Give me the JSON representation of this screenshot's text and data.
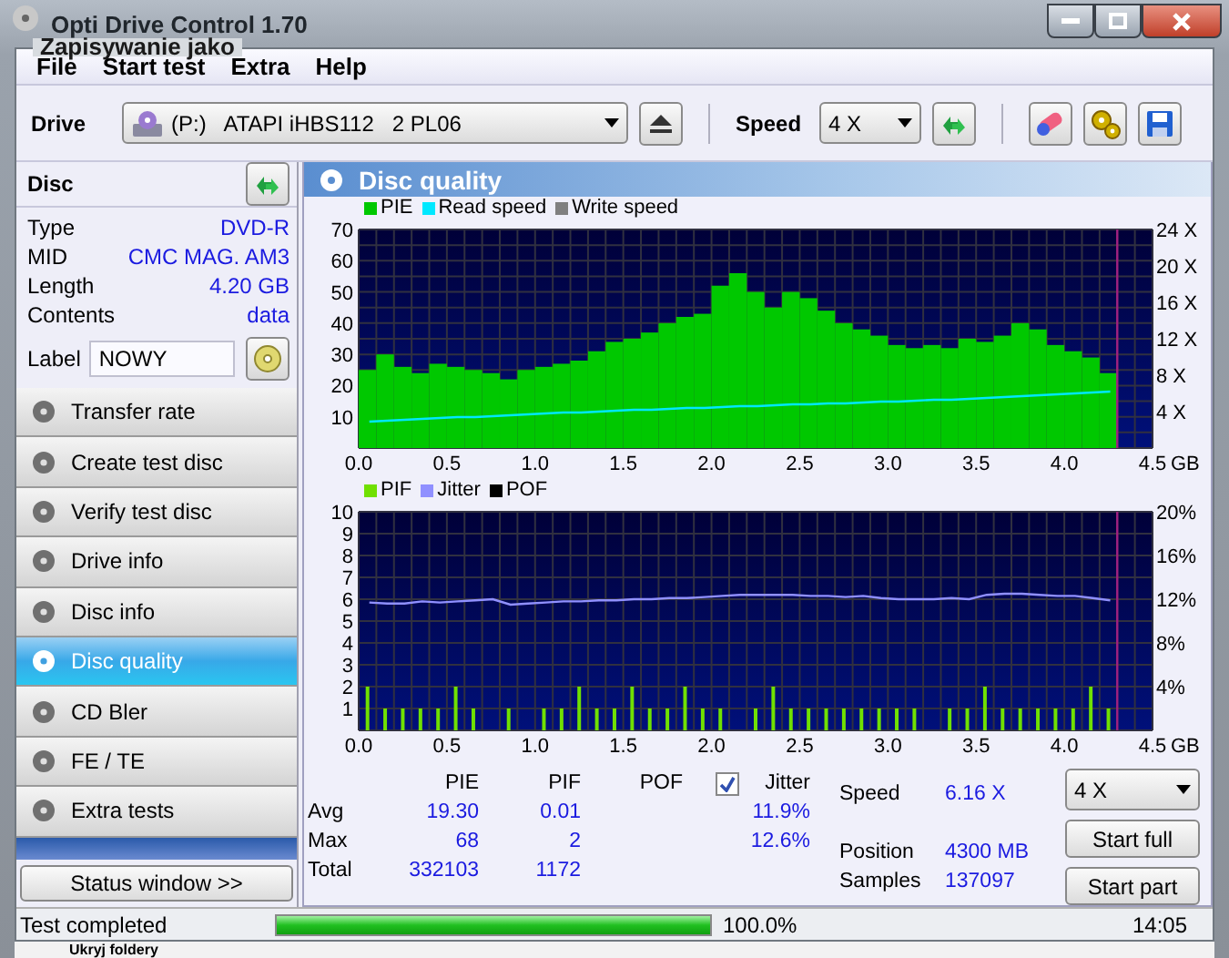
{
  "window": {
    "title": "Opti Drive Control 1.70"
  },
  "background_window": {
    "title": "Zapisywanie jako",
    "footer": "Ukryj foldery"
  },
  "menu": [
    "File",
    "Start test",
    "Extra",
    "Help"
  ],
  "toolbar": {
    "drive_label": "Drive",
    "drive": "(P:)   ATAPI iHBS112   2 PL06",
    "speed_label": "Speed",
    "speed": "4 X"
  },
  "disc": {
    "title": "Disc",
    "fields": [
      {
        "label": "Type",
        "value": "DVD-R"
      },
      {
        "label": "MID",
        "value": "CMC MAG. AM3"
      },
      {
        "label": "Length",
        "value": "4.20 GB"
      },
      {
        "label": "Contents",
        "value": "data"
      }
    ],
    "label_field": {
      "label": "Label",
      "value": "NOWY"
    }
  },
  "nav": [
    {
      "label": "Transfer rate",
      "selected": false
    },
    {
      "label": "Create test disc",
      "selected": false
    },
    {
      "label": "Verify test disc",
      "selected": false
    },
    {
      "label": "Drive info",
      "selected": false
    },
    {
      "label": "Disc info",
      "selected": false
    },
    {
      "label": "Disc quality",
      "selected": true
    },
    {
      "label": "CD Bler",
      "selected": false
    },
    {
      "label": "FE / TE",
      "selected": false
    },
    {
      "label": "Extra tests",
      "selected": false
    }
  ],
  "status_window_button": "Status window >>",
  "panel": {
    "title": "Disc quality",
    "charts": [
      {
        "extra_legend": [
          {
            "label": "Write speed",
            "color": "#808080"
          }
        ],
        "chart_data": {
          "type": "bar",
          "xlabel": "GB",
          "xlim": [
            0,
            4.5
          ],
          "ylim": [
            0,
            70
          ],
          "y2lim": [
            0,
            24
          ],
          "grid": true,
          "ref_lines": [
            {
              "axis": "x",
              "value": 4.3,
              "color": "#a02080"
            }
          ],
          "xticks": [
            {
              "value": 0,
              "label": "0.0"
            },
            {
              "value": 0.5,
              "label": "0.5"
            },
            {
              "value": 1,
              "label": "1.0"
            },
            {
              "value": 1.5,
              "label": "1.5"
            },
            {
              "value": 2,
              "label": "2.0"
            },
            {
              "value": 2.5,
              "label": "2.5"
            },
            {
              "value": 3,
              "label": "3.0"
            },
            {
              "value": 3.5,
              "label": "3.5"
            },
            {
              "value": 4,
              "label": "4.0"
            },
            {
              "value": 4.5,
              "label": "4.5"
            }
          ],
          "yticks": [
            10,
            20,
            30,
            40,
            50,
            60,
            70
          ],
          "x": [
            0.05,
            0.15,
            0.25,
            0.35,
            0.45,
            0.55,
            0.65,
            0.75,
            0.85,
            0.95,
            1.05,
            1.15,
            1.25,
            1.35,
            1.45,
            1.55,
            1.65,
            1.75,
            1.85,
            1.95,
            2.05,
            2.15,
            2.25,
            2.35,
            2.45,
            2.55,
            2.65,
            2.75,
            2.85,
            2.95,
            3.05,
            3.15,
            3.25,
            3.35,
            3.45,
            3.55,
            3.65,
            3.75,
            3.85,
            3.95,
            4.05,
            4.15,
            4.25
          ],
          "y2ticks": [
            {
              "value": 4,
              "label": "4 X"
            },
            {
              "value": 8,
              "label": "8 X"
            },
            {
              "value": 12,
              "label": "12 X"
            },
            {
              "value": 16,
              "label": "16 X"
            },
            {
              "value": 20,
              "label": "20 X"
            },
            {
              "value": 24,
              "label": "24 X"
            }
          ],
          "series": [
            {
              "name": "PIE",
              "color": "#00c800",
              "values": [
                25,
                30,
                26,
                24,
                27,
                26,
                25,
                24,
                22,
                25,
                26,
                27,
                28,
                31,
                34,
                35,
                37,
                40,
                42,
                43,
                52,
                56,
                50,
                45,
                50,
                48,
                44,
                40,
                38,
                36,
                33,
                32,
                33,
                32,
                35,
                34,
                36,
                40,
                38,
                33,
                31,
                29,
                24
              ]
            },
            {
              "name": "Read speed",
              "type": "line",
              "axis": "y2",
              "color": "#00e8ff",
              "values": [
                2.9,
                3,
                3.1,
                3.2,
                3.3,
                3.4,
                3.4,
                3.5,
                3.6,
                3.7,
                3.8,
                3.9,
                3.9,
                4,
                4.1,
                4.2,
                4.2,
                4.3,
                4.4,
                4.4,
                4.5,
                4.6,
                4.6,
                4.7,
                4.8,
                4.8,
                4.9,
                4.9,
                5,
                5.1,
                5.1,
                5.2,
                5.3,
                5.3,
                5.4,
                5.5,
                5.6,
                5.7,
                5.8,
                5.9,
                6,
                6.1,
                6.2
              ]
            }
          ]
        }
      },
      {
        "extra_legend": [
          {
            "label": "POF",
            "color": "#000000"
          }
        ],
        "chart_data": {
          "type": "bar",
          "xlabel": "GB",
          "xlim": [
            0,
            4.5
          ],
          "ylim": [
            0,
            10
          ],
          "y2lim": [
            0,
            20
          ],
          "grid": true,
          "ref_lines": [
            {
              "axis": "x",
              "value": 4.3,
              "color": "#a02080"
            }
          ],
          "xticks": [
            {
              "value": 0,
              "label": "0.0"
            },
            {
              "value": 0.5,
              "label": "0.5"
            },
            {
              "value": 1,
              "label": "1.0"
            },
            {
              "value": 1.5,
              "label": "1.5"
            },
            {
              "value": 2,
              "label": "2.0"
            },
            {
              "value": 2.5,
              "label": "2.5"
            },
            {
              "value": 3,
              "label": "3.0"
            },
            {
              "value": 3.5,
              "label": "3.5"
            },
            {
              "value": 4,
              "label": "4.0"
            },
            {
              "value": 4.5,
              "label": "4.5"
            }
          ],
          "yticks": [
            1,
            2,
            3,
            4,
            5,
            6,
            7,
            8,
            9,
            10
          ],
          "y2ticks": [
            {
              "value": 4,
              "label": "4%"
            },
            {
              "value": 8,
              "label": "8%"
            },
            {
              "value": 12,
              "label": "12%"
            },
            {
              "value": 16,
              "label": "16%"
            },
            {
              "value": 20,
              "label": "20%"
            }
          ],
          "x": [
            0.05,
            0.15,
            0.25,
            0.35,
            0.45,
            0.55,
            0.65,
            0.75,
            0.85,
            0.95,
            1.05,
            1.15,
            1.25,
            1.35,
            1.45,
            1.55,
            1.65,
            1.75,
            1.85,
            1.95,
            2.05,
            2.15,
            2.25,
            2.35,
            2.45,
            2.55,
            2.65,
            2.75,
            2.85,
            2.95,
            3.05,
            3.15,
            3.25,
            3.35,
            3.45,
            3.55,
            3.65,
            3.75,
            3.85,
            3.95,
            4.05,
            4.15,
            4.25
          ],
          "series": [
            {
              "name": "PIF",
              "color": "#70e000",
              "values": [
                2,
                1,
                1,
                1,
                1,
                2,
                1,
                0,
                1,
                0,
                1,
                1,
                2,
                1,
                1,
                2,
                1,
                1,
                2,
                1,
                1,
                0,
                1,
                2,
                1,
                1,
                1,
                1,
                1,
                1,
                1,
                1,
                0,
                1,
                1,
                2,
                1,
                1,
                1,
                1,
                1,
                2,
                1
              ]
            },
            {
              "name": "Jitter",
              "type": "line",
              "axis": "y2",
              "color": "#9090ff",
              "values": [
                11.7,
                11.6,
                11.6,
                11.8,
                11.7,
                11.8,
                11.9,
                12,
                11.5,
                11.6,
                11.7,
                11.8,
                11.8,
                11.9,
                11.9,
                12,
                12,
                12.1,
                12.1,
                12.2,
                12.3,
                12.4,
                12.4,
                12.4,
                12.4,
                12.3,
                12.3,
                12.2,
                12.3,
                12.1,
                12,
                12,
                12,
                12.1,
                12,
                12.4,
                12.5,
                12.5,
                12.4,
                12.3,
                12.3,
                12.1,
                11.9
              ]
            }
          ]
        }
      }
    ],
    "stats": {
      "columns": [
        "PIE",
        "PIF",
        "POF",
        "Jitter"
      ],
      "jitter_checked": true,
      "rows": [
        {
          "label": "Avg",
          "pie": "19.30",
          "pif": "0.01",
          "jitter": "11.9%"
        },
        {
          "label": "Max",
          "pie": "68",
          "pif": "2",
          "jitter": "12.6%"
        },
        {
          "label": "Total",
          "pie": "332103",
          "pif": "1172"
        }
      ],
      "info": [
        {
          "label": "Speed",
          "value": "6.16 X"
        },
        {
          "label": "Position",
          "value": "4300 MB"
        },
        {
          "label": "Samples",
          "value": "137097"
        }
      ],
      "speed": "4 X",
      "buttons": [
        "Start full",
        "Start part"
      ]
    }
  },
  "status_bar": {
    "text": "Test completed",
    "level": 1,
    "percent": "100.0%",
    "time": "14:05"
  }
}
